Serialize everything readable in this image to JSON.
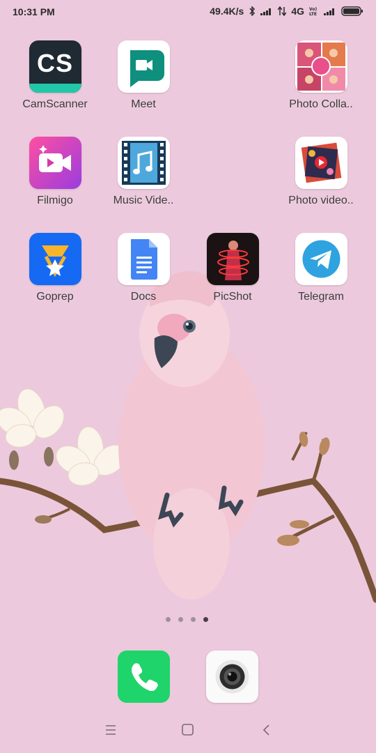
{
  "status_bar": {
    "time": "10:31 PM",
    "network_speed": "49.4K/s",
    "network_type": "4G",
    "volte": "Vo)\nLTE",
    "icons": [
      "bluetooth-icon",
      "signal-icon",
      "data-arrows-icon",
      "volte-icon",
      "signal-icon",
      "battery-icon"
    ]
  },
  "apps": [
    {
      "label": "CamScanner",
      "icon": "camscanner-icon",
      "text": "CS"
    },
    {
      "label": "Meet",
      "icon": "meet-icon"
    },
    {
      "label": "Photo Colla..",
      "icon": "photo-collage-icon"
    },
    {
      "label": "Filmigo",
      "icon": "filmigo-icon"
    },
    {
      "label": "Music Vide..",
      "icon": "music-video-icon"
    },
    {
      "label": "Photo video..",
      "icon": "photo-video-icon"
    },
    {
      "label": "Goprep",
      "icon": "goprep-icon"
    },
    {
      "label": "Docs",
      "icon": "docs-icon"
    },
    {
      "label": "PicShot",
      "icon": "picshot-icon"
    },
    {
      "label": "Telegram",
      "icon": "telegram-icon"
    }
  ],
  "page_indicator": {
    "pages": 4,
    "active": 4
  },
  "dock": [
    {
      "name": "Phone",
      "icon": "phone-icon"
    },
    {
      "name": "Camera",
      "icon": "camera-icon"
    }
  ],
  "nav_bar": [
    "menu-icon",
    "home-icon",
    "back-icon"
  ],
  "colors": {
    "wallpaper": "#ecc9dc",
    "phone": "#1fd46a",
    "telegram": "#2fa3e0"
  }
}
